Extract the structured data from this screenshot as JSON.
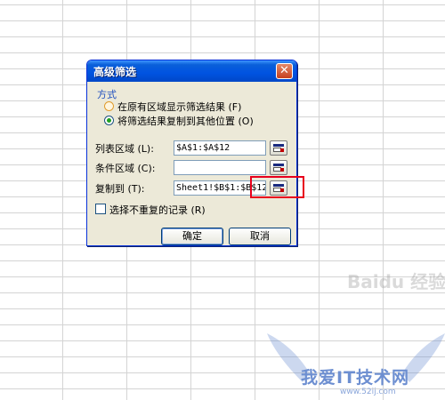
{
  "dialog": {
    "title": "高级筛选",
    "close_glyph": "✕",
    "group_title": "方式",
    "radio_in_place": "在原有区域显示筛选结果 (F)",
    "radio_copy": "将筛选结果复制到其他位置 (O)",
    "list_range_label": "列表区域 (L):",
    "list_range_value": "$A$1:$A$12",
    "criteria_range_label": "条件区域 (C):",
    "criteria_range_value": "",
    "copy_to_label": "复制到 (T):",
    "copy_to_value": "Sheet1!$B$1:$B$12",
    "unique_label": "选择不重复的记录 (R)",
    "ok_label": "确定",
    "cancel_label": "取消",
    "selected_mode": "copy",
    "unique_checked": false
  },
  "watermark": {
    "text": "我爱IT技术网",
    "url": "www.52ij.com",
    "baidu": "Baidu 经验"
  },
  "colors": {
    "titlebar": "#0053e1",
    "dialog_bg": "#ece9d8",
    "highlight": "#e8001c"
  },
  "icons": [
    "close-icon",
    "range-select-icon"
  ]
}
